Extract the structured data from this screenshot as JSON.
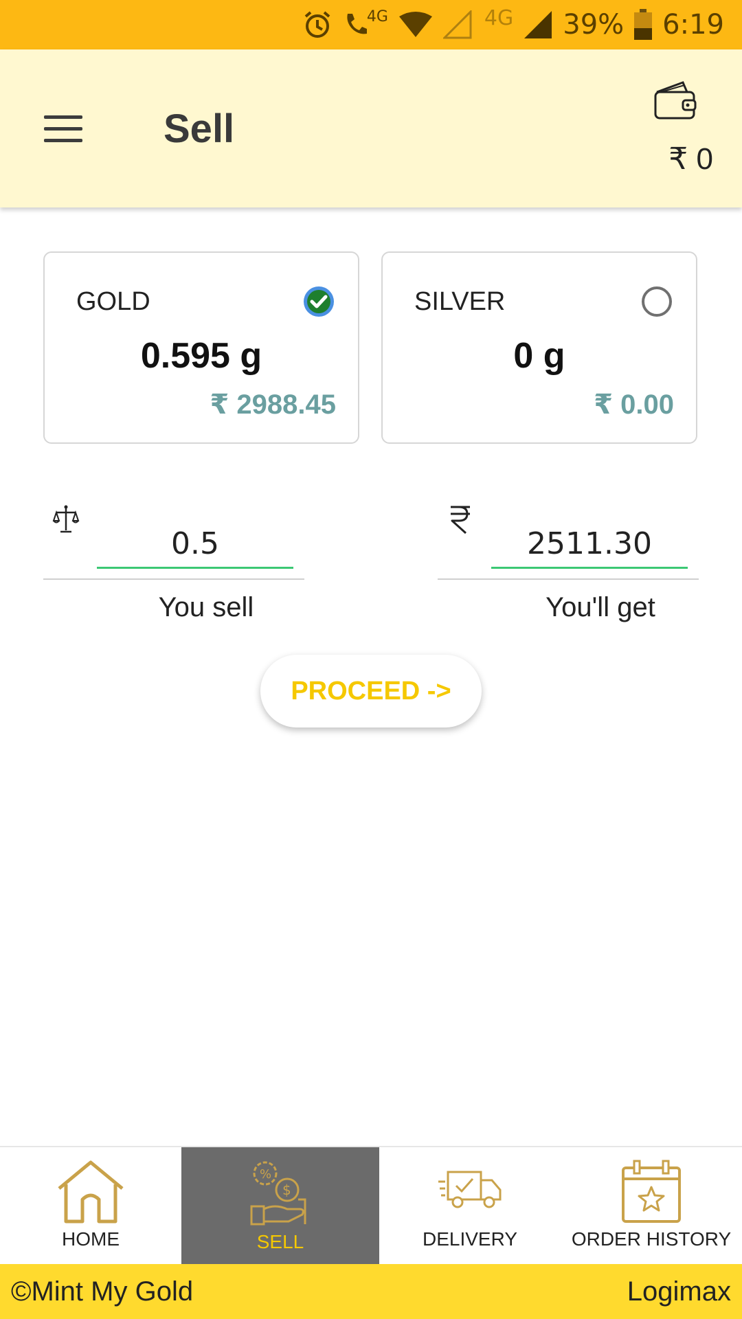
{
  "status_bar": {
    "net_small": "4G",
    "net_large": "4G",
    "battery": "39%",
    "time": "6:19",
    "icons": [
      "alarm-icon",
      "call-icon",
      "wifi-icon",
      "signal-empty-icon",
      "signal-full-icon",
      "battery-icon"
    ]
  },
  "app_bar": {
    "title": "Sell",
    "wallet_balance": "₹ 0",
    "icons": [
      "menu-icon",
      "wallet-icon"
    ]
  },
  "metals": [
    {
      "label": "GOLD",
      "weight": "0.595 g",
      "value": "₹ 2988.45",
      "selected": true
    },
    {
      "label": "SILVER",
      "weight": "0 g",
      "value": "₹ 0.00",
      "selected": false
    }
  ],
  "sell_form": {
    "sell_value": "0.5",
    "sell_caption": "You sell",
    "get_value": "2511.30",
    "get_caption": "You'll get",
    "icons": [
      "scale-icon",
      "rupee-icon"
    ]
  },
  "proceed_label": "PROCEED ->",
  "bottom_nav": [
    {
      "label": "HOME",
      "icon": "home-icon",
      "active": false
    },
    {
      "label": "SELL",
      "icon": "sell-icon",
      "active": true
    },
    {
      "label": "DELIVERY",
      "icon": "delivery-truck-icon",
      "active": false
    },
    {
      "label": "ORDER HISTORY",
      "icon": "calendar-star-icon",
      "active": false
    }
  ],
  "footer": {
    "left": "©Mint My Gold",
    "right": "Logimax"
  },
  "colors": {
    "status_bar": "#FDB813",
    "app_bar": "#FFF8D0",
    "accent_gold": "#C9A24A",
    "proceed_text": "#F5C800",
    "value_teal": "#6a9fa0",
    "input_underline": "#3cc874",
    "nav_active_bg": "#6b6b6b",
    "footer": "#FFDA2E"
  }
}
